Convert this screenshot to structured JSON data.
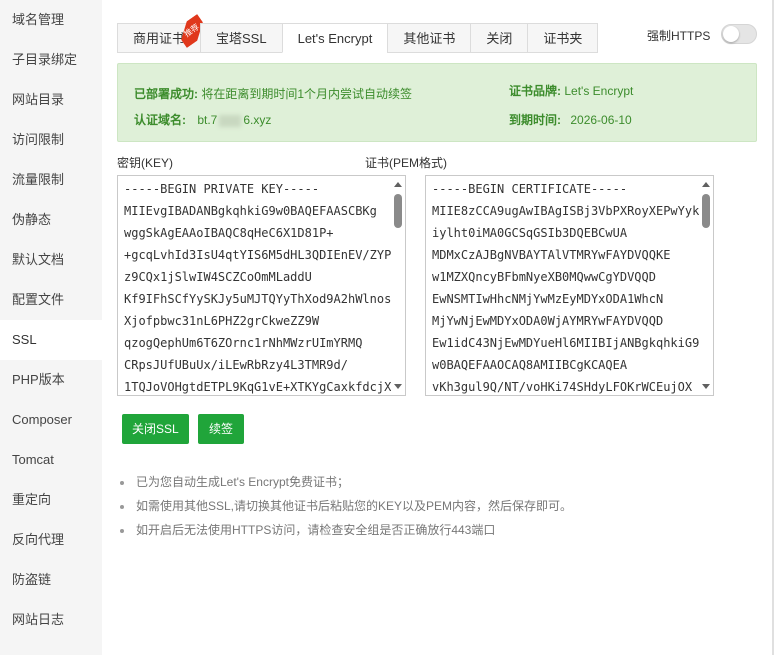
{
  "sidebar": {
    "items": [
      {
        "label": "域名管理"
      },
      {
        "label": "子目录绑定"
      },
      {
        "label": "网站目录"
      },
      {
        "label": "访问限制"
      },
      {
        "label": "流量限制"
      },
      {
        "label": "伪静态"
      },
      {
        "label": "默认文档"
      },
      {
        "label": "配置文件"
      },
      {
        "label": "SSL"
      },
      {
        "label": "PHP版本"
      },
      {
        "label": "Composer"
      },
      {
        "label": "Tomcat"
      },
      {
        "label": "重定向"
      },
      {
        "label": "反向代理"
      },
      {
        "label": "防盗链"
      },
      {
        "label": "网站日志"
      }
    ],
    "active_index": 8
  },
  "tabs": [
    {
      "label": "商用证书",
      "badge": "推荐"
    },
    {
      "label": "宝塔SSL"
    },
    {
      "label": "Let's Encrypt"
    },
    {
      "label": "其他证书"
    },
    {
      "label": "关闭"
    },
    {
      "label": "证书夹"
    }
  ],
  "active_tab": "Let's Encrypt",
  "force_https": {
    "label": "强制HTTPS",
    "enabled": false
  },
  "status": {
    "deployed_key": "已部署成功:",
    "deployed_value": "将在距离到期时间1个月内尝试自动续签",
    "domain_key": "认证域名:",
    "domain_prefix": "bt.7",
    "domain_suffix": "6.xyz",
    "brand_key": "证书品牌:",
    "brand_value": "Let's Encrypt",
    "expire_key": "到期时间:",
    "expire_value": "2026-06-10"
  },
  "key_label": "密钥(KEY)",
  "cert_label": "证书(PEM格式)",
  "private_key": "-----BEGIN PRIVATE KEY-----\nMIIEvgIBADANBgkqhkiG9w0BAQEFAASCBKg\nwggSkAgEAAoIBAQC8qHeC6X1D81P+\n+gcqLvhId3IsU4qtYIS6M5dHL3QDIEnEV/ZYPk\nz9CQx1jSlwIW4SCZCoOmMLaddU\nKf9IFhSCfYySKJy5uMJTQYyThXod9A2hWlnos\nXjofpbwc31nL6PHZ2grCkweZZ9W\nqzogQephUm6T6ZOrnc1rNhMWzrUImYRMQ\nCRpsJUfUBuUx/iLEwRbRzy4L3TMR9d/\n1TQJoVOHgtdETPL9KqG1vE+XTKYgCaxkfdcjX",
  "certificate": "-----BEGIN CERTIFICATE-----\nMIIE8zCCA9ugAwIBAgISBj3VbPXRoyXEPwYyk\niylht0iMA0GCSqGSIb3DQEBCwUA\nMDMxCzAJBgNVBAYTAlVTMRYwFAYDVQQKE\nw1MZXQncyBFbmNyeXB0MQwwCgYDVQQD\nEwNSMTIwHhcNMjYwMzEyMDYxODA1WhcN\nMjYwNjEwMDYxODA0WjAYMRYwFAYDVQQD\nEw1idC43NjEwMDYueHl6MIIBIjANBgkqhkiG9\nw0BAQEFAAOCAQ8AMIIBCgKCAQEA\nvKh3gul9Q/NT/voHKi74SHdyLFOKrWCEujOX",
  "buttons": {
    "close_ssl": "关闭SSL",
    "renew": "续签"
  },
  "notes": [
    "已为您自动生成Let's Encrypt免费证书；",
    "如需使用其他SSL,请切换其他证书后粘贴您的KEY以及PEM内容，然后保存即可。",
    "如开启后无法使用HTTPS访问，请检查安全组是否正确放行443端口"
  ]
}
